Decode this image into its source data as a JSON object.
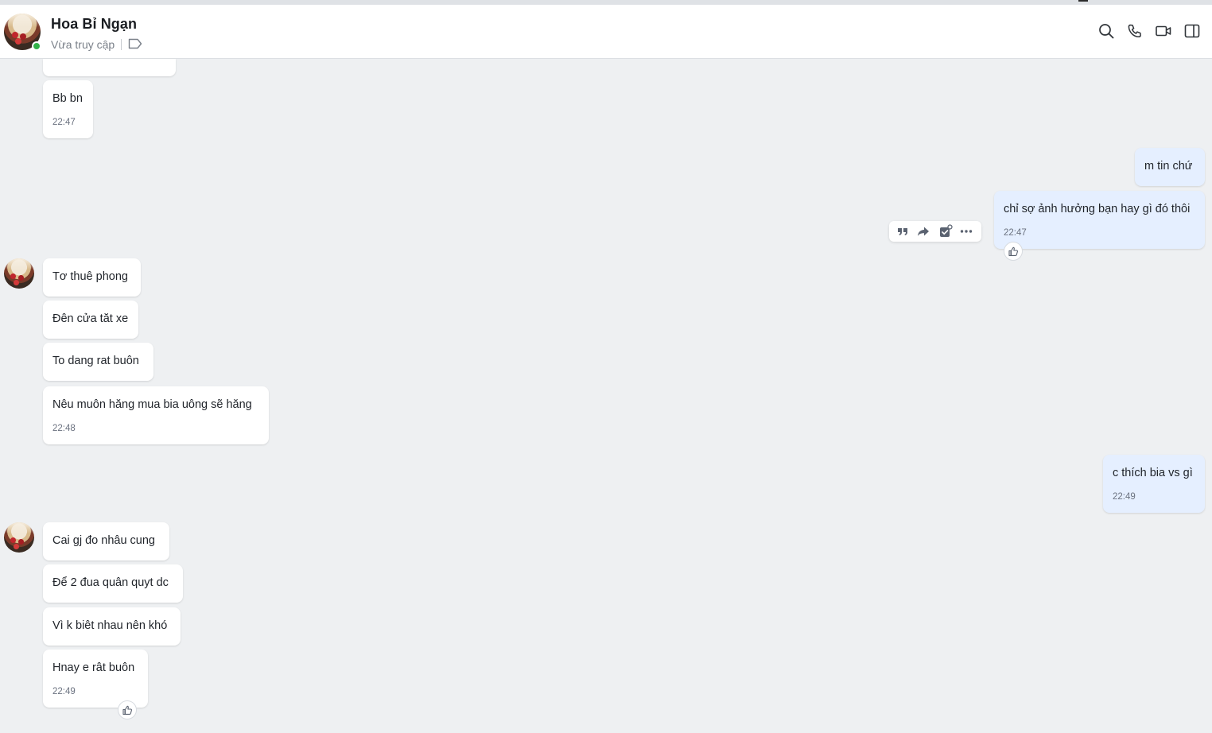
{
  "header": {
    "contact_name": "Hoa Bỉ Ngạn",
    "status": "Vừa truy cập",
    "icons": [
      "search-icon",
      "phone-icon",
      "video-call-icon",
      "sidebar-toggle-icon",
      "label-tag-icon"
    ]
  },
  "message_actions": {
    "icons": [
      "quote-icon",
      "forward-icon",
      "task-icon",
      "more-icon"
    ]
  },
  "messages": [
    {
      "direction": "in",
      "text": "",
      "time": ""
    },
    {
      "direction": "in",
      "text": "Bb bn",
      "time": "22:47"
    },
    {
      "direction": "out",
      "text": "m tin chứ",
      "time": ""
    },
    {
      "direction": "out",
      "text": "chỉ sợ ảnh hưởng bạn hay gì đó thôi",
      "time": "22:47"
    },
    {
      "direction": "in",
      "text": "Tơ thuê phong",
      "time": ""
    },
    {
      "direction": "in",
      "text": "Đên cửa tăt xe",
      "time": ""
    },
    {
      "direction": "in",
      "text": "To dang rat buôn",
      "time": ""
    },
    {
      "direction": "in",
      "text": "Nêu muôn hăng mua bia uông sẽ hăng",
      "time": "22:48"
    },
    {
      "direction": "out",
      "text": "c thích bia vs gì",
      "time": "22:49"
    },
    {
      "direction": "in",
      "text": "Cai gj đo nhâu cung",
      "time": ""
    },
    {
      "direction": "in",
      "text": "Để 2 đua quân quyt dc",
      "time": ""
    },
    {
      "direction": "in",
      "text": "Vì k biêt nhau nên khó",
      "time": ""
    },
    {
      "direction": "in",
      "text": "Hnay e rât buôn",
      "time": "22:49"
    }
  ],
  "colors": {
    "background": "#eef0f2",
    "incoming_bubble": "#ffffff",
    "outgoing_bubble": "#e5efff",
    "online": "#31b249"
  }
}
